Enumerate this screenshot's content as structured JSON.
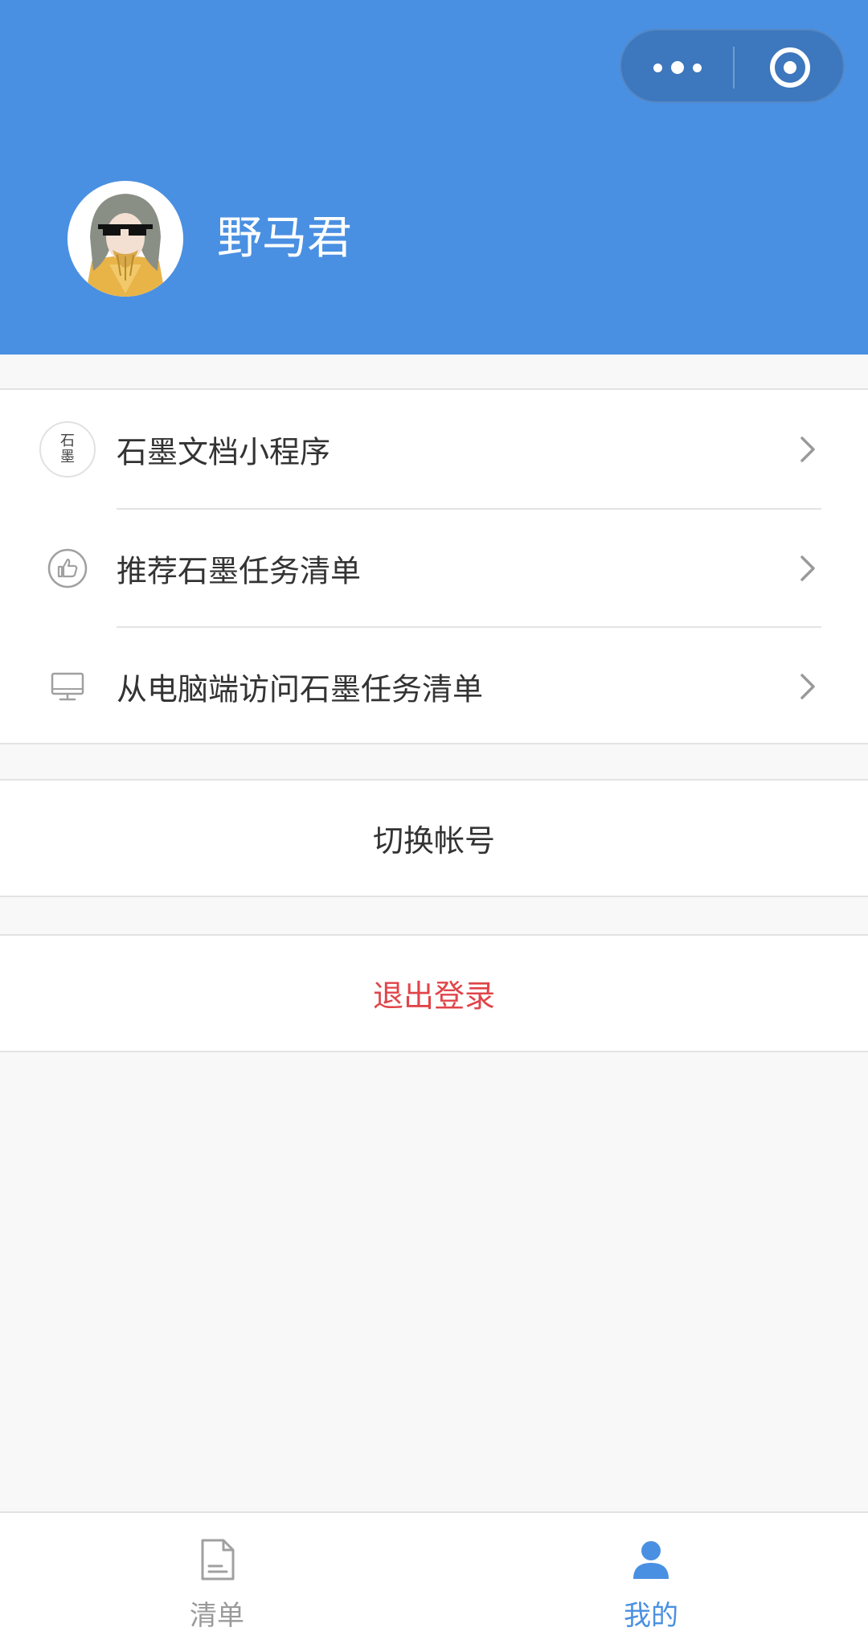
{
  "header": {
    "username": "野马君",
    "background_color": "#4a90e2",
    "capsule": {
      "more_icon": "more-dots-icon",
      "close_icon": "target-circle-icon"
    }
  },
  "menu": {
    "items": [
      {
        "label": "石墨文档小程序",
        "icon": "shimo-logo-icon",
        "icon_text_top": "石",
        "icon_text_bottom": "墨"
      },
      {
        "label": "推荐石墨任务清单",
        "icon": "thumbs-up-icon"
      },
      {
        "label": "从电脑端访问石墨任务清单",
        "icon": "monitor-icon"
      }
    ]
  },
  "actions": {
    "switch_account": "切换帐号",
    "logout": "退出登录",
    "logout_color": "#e0454a"
  },
  "tabbar": {
    "tabs": [
      {
        "label": "清单",
        "icon": "document-icon",
        "active": false
      },
      {
        "label": "我的",
        "icon": "user-icon",
        "active": true
      }
    ],
    "active_color": "#4a90e2",
    "inactive_color": "#9a9a9a"
  }
}
